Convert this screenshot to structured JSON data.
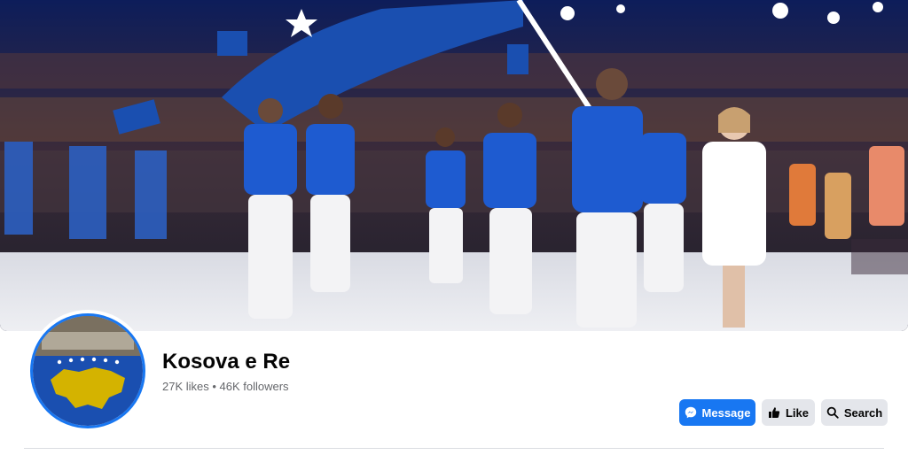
{
  "page": {
    "name": "Kosova e Re",
    "stats": "27K likes • 46K followers"
  },
  "actions": {
    "message_label": "Message",
    "like_label": "Like",
    "search_label": "Search"
  },
  "icons": {
    "message": "messenger-icon",
    "like": "thumbs-up-icon",
    "search": "search-icon"
  },
  "colors": {
    "primary": "#1877f2",
    "secondary_button": "#e4e6eb",
    "text_primary": "#050505",
    "text_secondary": "#65676b",
    "flag_blue": "#1a4fb0",
    "flag_gold": "#d4b300"
  }
}
